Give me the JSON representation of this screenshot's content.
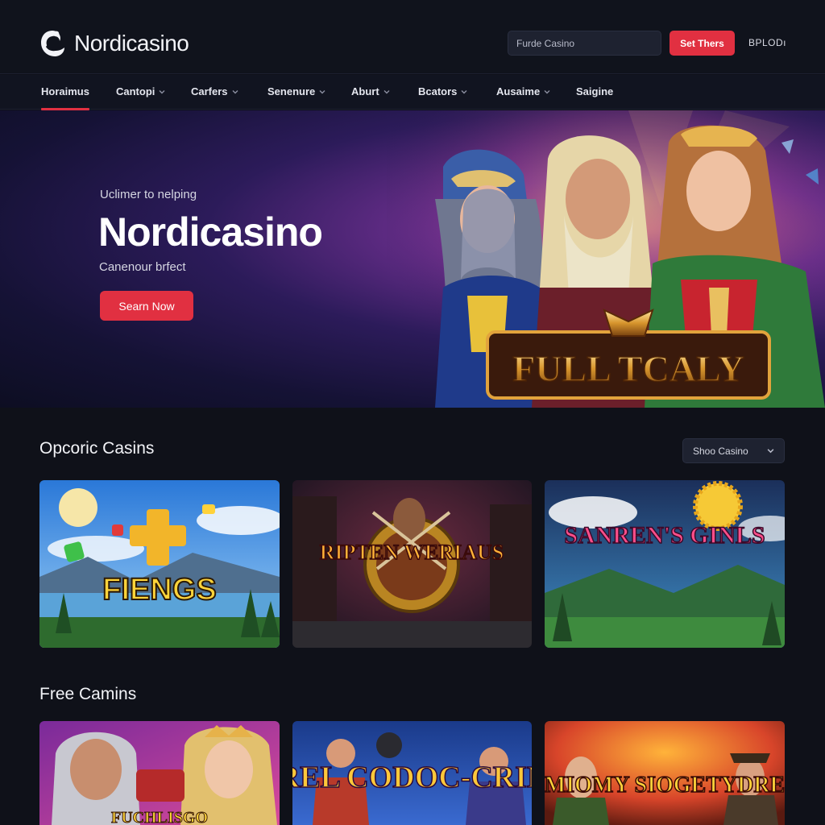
{
  "header": {
    "brand": "Nordicasino",
    "search_placeholder": "Furde Casino",
    "cta_label": "Set Thers",
    "login_label": "BPLODı"
  },
  "nav": {
    "items": [
      {
        "label": "Horaimus",
        "active": true
      },
      {
        "label": "Cantopi"
      },
      {
        "label": "Carfers"
      },
      {
        "label": "Senenure"
      },
      {
        "label": "Aburt"
      },
      {
        "label": "Bcators"
      },
      {
        "label": "Ausaime"
      },
      {
        "label": "Saigine"
      }
    ]
  },
  "hero": {
    "kicker": "Uclimer to nelping",
    "title": "Nordicasino",
    "tagline": "Canenour brfect",
    "button_label": "Searn Now",
    "game_logo": "FULL TCALY"
  },
  "section_popular": {
    "title": "Opcoric Casins",
    "filter_value": "Shoo Casino",
    "games": [
      {
        "title": "FIENGS"
      },
      {
        "title": "RIPTEN WERIAUS"
      },
      {
        "title": "SANREN'S GINLS"
      }
    ]
  },
  "section_free": {
    "title": "Free Camins",
    "games": [
      {
        "title": "FUCHLISGO"
      },
      {
        "title": "CAREL CODOC-CRINTE"
      },
      {
        "title": "MIOMY SIOGETYDRE"
      }
    ]
  },
  "colors": {
    "background": "#0f1119",
    "accent": "#e13041",
    "header": "#10131c",
    "input": "#1e2230"
  },
  "icons": {
    "logo": "swirl-logo-icon",
    "dropdown": "chevron-down-icon"
  }
}
